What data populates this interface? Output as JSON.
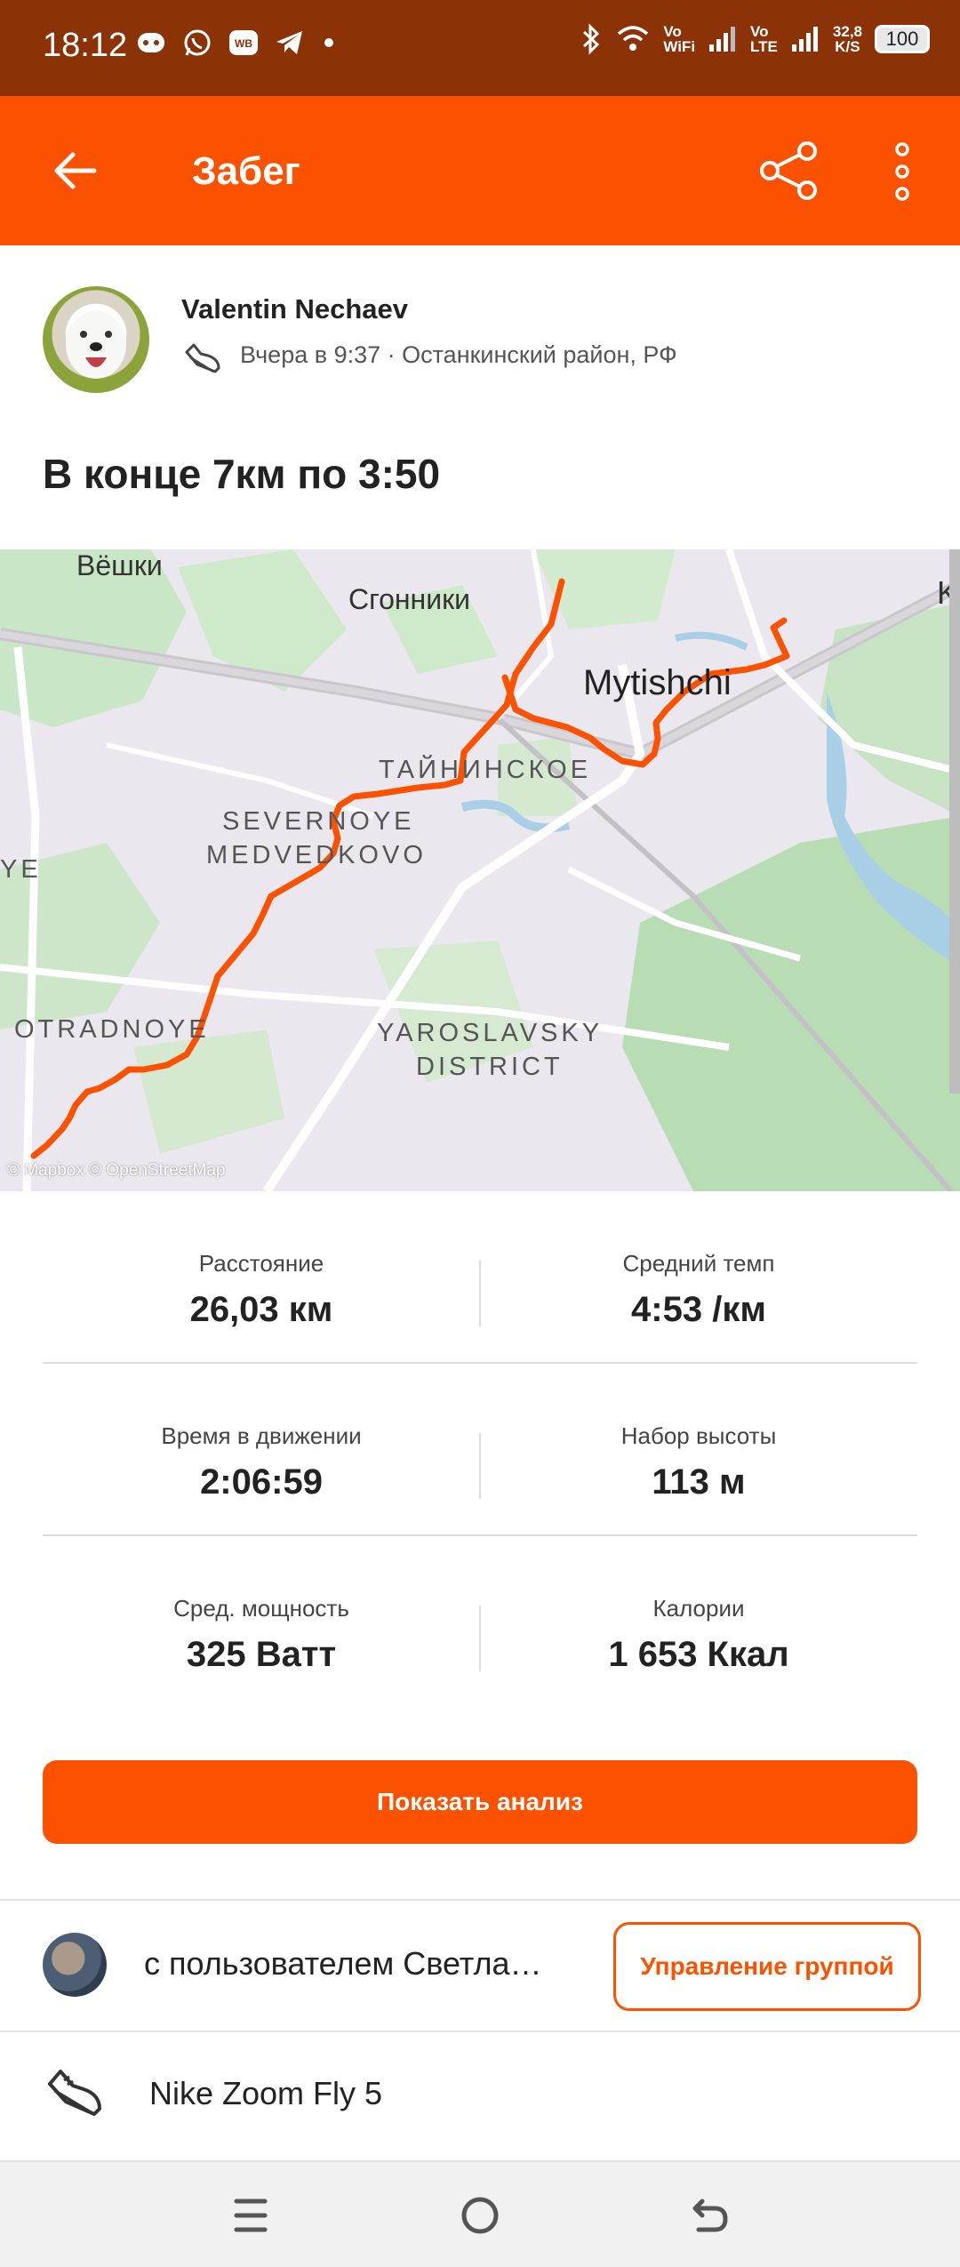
{
  "status_bar": {
    "time": "18:12",
    "notification_icons": [
      "robot-icon",
      "whatsapp-icon",
      "wb-icon",
      "telegram-icon",
      "dot-icon"
    ],
    "vo_wifi": "Vo\nWiFi",
    "vo_lte": "Vo\nLTE",
    "net_speed": "32,8\nK/S",
    "battery": "100"
  },
  "toolbar": {
    "title": "Забег",
    "accent": "#fc5200"
  },
  "athlete": {
    "name": "Valentin Nechaev",
    "meta": "Вчера в 9:37 · Останкинский район, РФ"
  },
  "activity": {
    "title": "В конце 7км по 3:50"
  },
  "map": {
    "labels": {
      "veshki": "Вёшки",
      "sgonniki": "Сгонники",
      "mytishchi": "Mytishchi",
      "tainiskoe": "ТАЙНИНСКОЕ",
      "severnoye": "SEVERNOYE",
      "medvedkovo": "MEDVEDKOVO",
      "otradnoye": "OTRADNOYE",
      "yaroslavsky": "YAROSLAVSKY",
      "district": "DISTRICT",
      "attribution": "© Mapbox © OpenStreetMap",
      "edge_k": "K",
      "edge_ye": "YE"
    },
    "route_color": "#fc5200"
  },
  "stats": [
    {
      "label": "Расстояние",
      "value": "26,03 км"
    },
    {
      "label": "Средний темп",
      "value": "4:53 /км"
    },
    {
      "label": "Время в движении",
      "value": "2:06:59"
    },
    {
      "label": "Набор высоты",
      "value": "113 м"
    },
    {
      "label": "Сред. мощность",
      "value": "325 Ватт"
    },
    {
      "label": "Калории",
      "value": "1 653 Ккал"
    }
  ],
  "analysis_button": "Показать анализ",
  "group": {
    "text": "с пользователем Светла…",
    "manage_button": "Управление группой"
  },
  "gear": {
    "name": "Nike Zoom Fly 5"
  }
}
